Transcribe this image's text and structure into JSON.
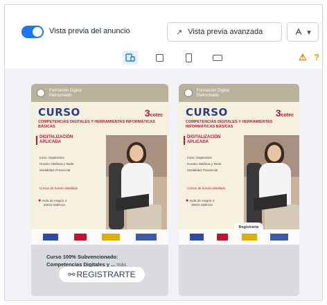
{
  "topbar": {
    "toggle_label": "Vista previa del anuncio",
    "advanced_button": "Vista previa avanzada",
    "share_caret": "▾"
  },
  "devices": [
    {
      "name": "mobile-feed",
      "active": true
    },
    {
      "name": "square",
      "active": false
    },
    {
      "name": "vertical",
      "active": false
    },
    {
      "name": "horizontal",
      "active": false
    }
  ],
  "colors": {
    "accent": "#1877f2",
    "brand_red": "#c8102e",
    "brand_blue": "#2c3b8a",
    "warning": "#e47b00"
  },
  "icons": {
    "warning": "⚠",
    "link": "🔗"
  },
  "story": {
    "page_name_line1": "Formación Digital",
    "page_name_line2": "Patrocinado",
    "curso": "CURSO",
    "brand": "cotec",
    "subtitle": "COMPETENCIAS DIGITALES Y HERRAMIENTAS INFORMÁTICAS BÁSICAS",
    "section": "DIGITALIZACIÓN APLICADA",
    "info1": "Inicio: Septiembre",
    "info2": "Horario: Mañana y Tarde",
    "info3": "Modalidad: Presencial",
    "mas_info": "Cursos de horario detallado",
    "location_line1": "Avda de Aragón 3",
    "location_line2": "46010 València"
  },
  "preview1": {
    "caption_line1": "Curso 100% Subvencionado:",
    "caption_line2": "Competencias Digitales y ...",
    "caption_more": "más",
    "cta": "REGISTRARTE"
  },
  "preview2": {
    "badge": "Registrarte"
  }
}
